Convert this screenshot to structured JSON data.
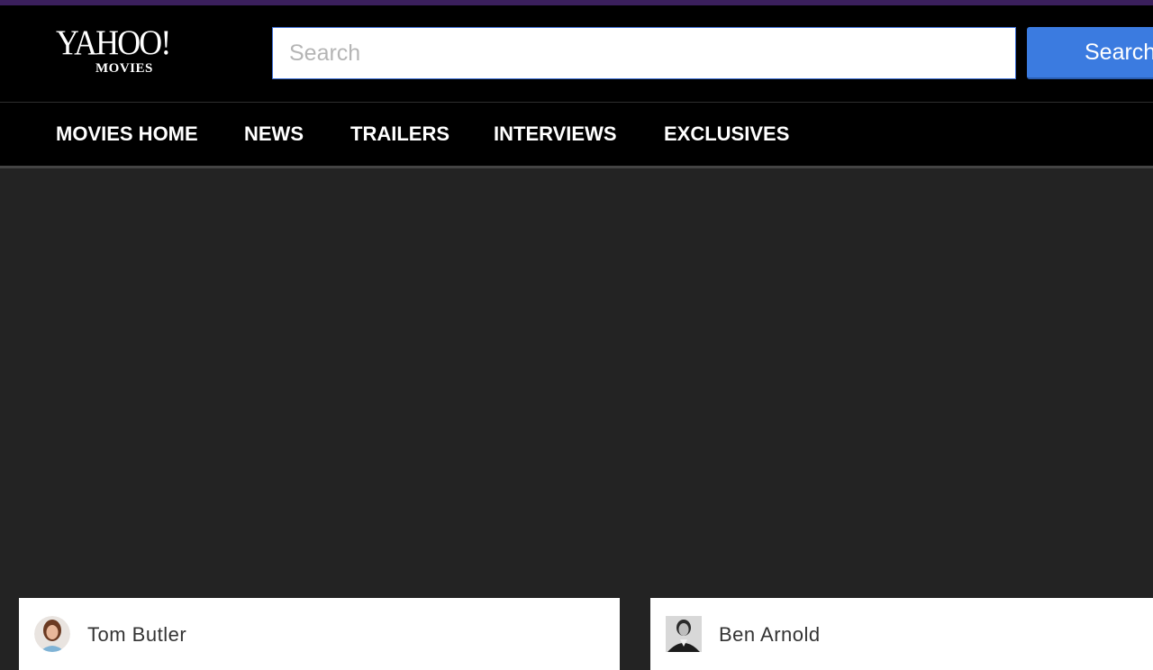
{
  "header": {
    "logo_main": "YAHOO!",
    "logo_sub": "MOVIES",
    "search_placeholder": "Search",
    "search_button_label": "Search"
  },
  "nav": {
    "items": [
      {
        "label": "MOVIES HOME"
      },
      {
        "label": "NEWS"
      },
      {
        "label": "TRAILERS"
      },
      {
        "label": "INTERVIEWS"
      },
      {
        "label": "EXCLUSIVES"
      }
    ]
  },
  "cards": [
    {
      "author": "Tom Butler"
    },
    {
      "author": "Ben Arnold"
    }
  ],
  "colors": {
    "top_strip": "#3a1f5c",
    "header_bg": "#000000",
    "page_bg": "#232323",
    "search_button": "#3b7be0"
  }
}
